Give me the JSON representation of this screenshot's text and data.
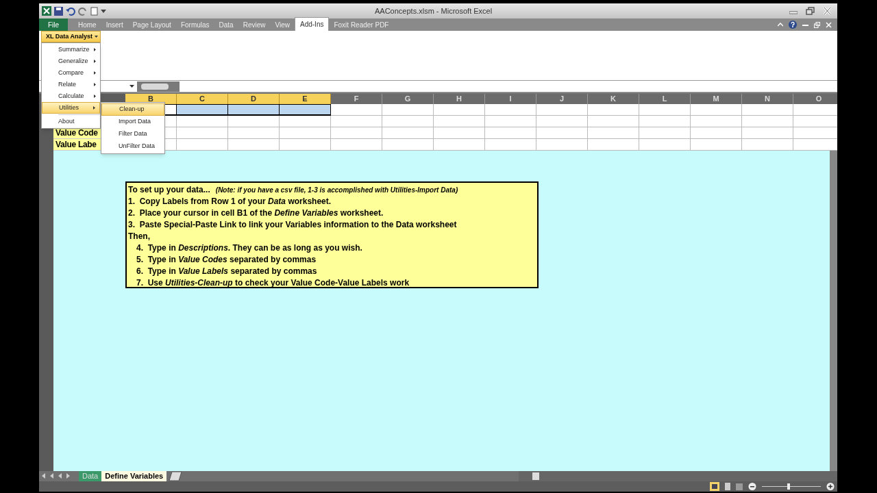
{
  "window": {
    "title": "AAConcepts.xlsm - Microsoft Excel"
  },
  "ribbon_tabs": [
    {
      "label": "File",
      "kind": "file",
      "selected": false
    },
    {
      "label": "Home",
      "kind": "tab",
      "selected": false
    },
    {
      "label": "Insert",
      "kind": "tab",
      "selected": false
    },
    {
      "label": "Page Layout",
      "kind": "tab",
      "selected": false
    },
    {
      "label": "Formulas",
      "kind": "tab",
      "selected": false
    },
    {
      "label": "Data",
      "kind": "tab",
      "selected": false
    },
    {
      "label": "Review",
      "kind": "tab",
      "selected": false
    },
    {
      "label": "View",
      "kind": "tab",
      "selected": false
    },
    {
      "label": "Add-Ins",
      "kind": "tab",
      "selected": true
    },
    {
      "label": "Foxit Reader PDF",
      "kind": "tab",
      "selected": false
    }
  ],
  "addin_button": {
    "label": "XL Data Analyst"
  },
  "menu": {
    "items": [
      {
        "label": "Summarize",
        "has_submenu": true,
        "selected": false
      },
      {
        "label": "Generalize",
        "has_submenu": true,
        "selected": false
      },
      {
        "label": "Compare",
        "has_submenu": true,
        "selected": false
      },
      {
        "label": "Relate",
        "has_submenu": true,
        "selected": false
      },
      {
        "label": "Calculate",
        "has_submenu": true,
        "selected": false
      },
      {
        "label": "Utilities",
        "has_submenu": true,
        "selected": true
      },
      {
        "label": "About",
        "has_submenu": false,
        "selected": false
      }
    ]
  },
  "submenu": {
    "items": [
      {
        "label": "Clean-up",
        "selected": true
      },
      {
        "label": "Import Data",
        "selected": false
      },
      {
        "label": "Filter Data",
        "selected": false
      },
      {
        "label": "UnFilter Data",
        "selected": false
      }
    ]
  },
  "columns": [
    {
      "label": "B",
      "selected": true
    },
    {
      "label": "C",
      "selected": true
    },
    {
      "label": "D",
      "selected": true
    },
    {
      "label": "E",
      "selected": true
    },
    {
      "label": "F",
      "selected": false
    },
    {
      "label": "G",
      "selected": false
    },
    {
      "label": "H",
      "selected": false
    },
    {
      "label": "I",
      "selected": false
    },
    {
      "label": "J",
      "selected": false
    },
    {
      "label": "K",
      "selected": false
    },
    {
      "label": "L",
      "selected": false
    },
    {
      "label": "M",
      "selected": false
    },
    {
      "label": "N",
      "selected": false
    },
    {
      "label": "O",
      "selected": false
    }
  ],
  "column_a_cells": [
    "Value Code",
    "Value Labe"
  ],
  "note": {
    "heading": "To set up your data...",
    "aside": "(Note: if you have a csv file, 1-3 is accomplished with Utilities-Import Data)",
    "lines": [
      {
        "kind": "step",
        "text": "1.  Copy Labels from Row 1 of your *Data* worksheet."
      },
      {
        "kind": "step",
        "text": "2.  Place your cursor in cell B1 of the *Define Variables* worksheet."
      },
      {
        "kind": "step",
        "text": "3.  Paste Special-Paste Link to link your Variables information to the Data worksheet"
      },
      {
        "kind": "step",
        "text": "Then,"
      },
      {
        "kind": "indented",
        "text": "4.  Type in *Descriptions*. They can be as long as you wish."
      },
      {
        "kind": "indented",
        "text": "5.  Type in *Value Codes* separated by commas"
      },
      {
        "kind": "indented",
        "text": "6.  Type in *Value Labels* separated by commas"
      },
      {
        "kind": "indented",
        "text": "7.  Use *Utilities-Clean-up* to check your Value Code-Value Labels work"
      }
    ]
  },
  "zoom_slider": {
    "level": 0.45
  },
  "sheet_tabs": [
    {
      "label": "Data",
      "selected": false
    },
    {
      "label": "Define Variables",
      "selected": true
    }
  ]
}
